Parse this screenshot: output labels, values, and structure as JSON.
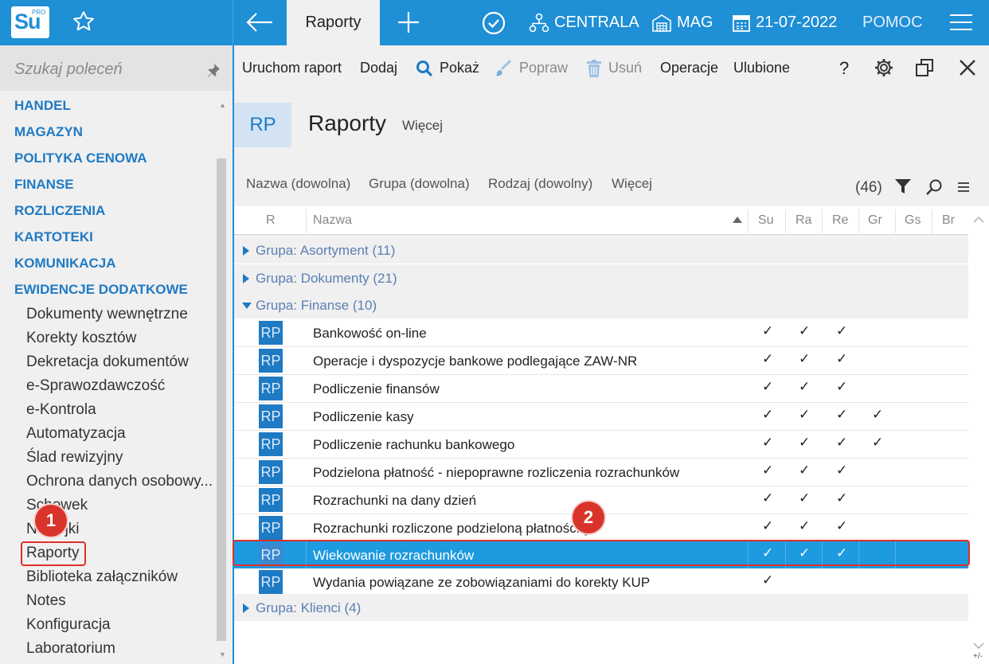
{
  "app": {
    "logo_text": "Su",
    "logo_sup": "PRO",
    "active_tab": "Raporty",
    "branch": "CENTRALA",
    "warehouse": "MAG",
    "date": "21-07-2022",
    "help": "POMOC"
  },
  "sidebar": {
    "search_placeholder": "Szukaj poleceń",
    "sections": [
      "HANDEL",
      "MAGAZYN",
      "POLITYKA CENOWA",
      "FINANSE",
      "ROZLICZENIA",
      "KARTOTEKI",
      "KOMUNIKACJA",
      "EWIDENCJE DODATKOWE"
    ],
    "items": [
      "Dokumenty wewnętrzne",
      "Korekty kosztów",
      "Dekretacja dokumentów",
      "e-Sprawozdawczość",
      "e-Kontrola",
      "Automatyzacja",
      "Ślad rewizyjny",
      "Ochrona danych osobowy...",
      "Schowek",
      "Naklejki",
      "Raporty",
      "Biblioteka załączników",
      "Notes",
      "Konfiguracja",
      "Laboratorium"
    ]
  },
  "toolbar": {
    "run": "Uruchom raport",
    "add": "Dodaj",
    "show": "Pokaż",
    "edit": "Popraw",
    "delete": "Usuń",
    "operations": "Operacje",
    "favorites": "Ulubione",
    "help_q": "?"
  },
  "header": {
    "badge": "RP",
    "title": "Raporty",
    "more": "Więcej"
  },
  "filters": {
    "name": "Nazwa (dowolna)",
    "group": "Grupa (dowolna)",
    "kind": "Rodzaj (dowolny)",
    "more": "Więcej",
    "count": "(46)"
  },
  "table": {
    "columns": [
      "R",
      "Nazwa",
      "Su",
      "Ra",
      "Re",
      "Gr",
      "Gs",
      "Br"
    ],
    "groups": [
      {
        "label": "Grupa: Asortyment (11)",
        "expanded": false
      },
      {
        "label": "Grupa: Dokumenty (21)",
        "expanded": false
      },
      {
        "label": "Grupa: Finanse (10)",
        "expanded": true
      },
      {
        "label": "Grupa: Klienci (4)",
        "expanded": false
      }
    ],
    "icon_text": "RP",
    "check": "✓",
    "rows": [
      {
        "name": "Bankowość on-line",
        "su": true,
        "ra": true,
        "re": true,
        "gr": false
      },
      {
        "name": "Operacje i dyspozycje bankowe podlegające ZAW-NR",
        "su": true,
        "ra": true,
        "re": true,
        "gr": false
      },
      {
        "name": "Podliczenie finansów",
        "su": true,
        "ra": true,
        "re": true,
        "gr": false
      },
      {
        "name": "Podliczenie kasy",
        "su": true,
        "ra": true,
        "re": true,
        "gr": true
      },
      {
        "name": "Podliczenie rachunku bankowego",
        "su": true,
        "ra": true,
        "re": true,
        "gr": true
      },
      {
        "name": "Podzielona płatność - niepoprawne rozliczenia rozrachunków",
        "su": true,
        "ra": true,
        "re": true,
        "gr": false
      },
      {
        "name": "Rozrachunki na dany dzień",
        "su": true,
        "ra": true,
        "re": true,
        "gr": false
      },
      {
        "name": "Rozrachunki rozliczone podzieloną płatnością",
        "su": true,
        "ra": true,
        "re": true,
        "gr": false
      },
      {
        "name": "Wiekowanie rozrachunków",
        "su": true,
        "ra": true,
        "re": true,
        "gr": false,
        "selected": true
      },
      {
        "name": "Wydania powiązane ze zobowiązaniami do korekty KUP",
        "su": true,
        "ra": false,
        "re": false,
        "gr": false
      }
    ]
  },
  "callouts": {
    "one": "1",
    "two": "2"
  },
  "corner": "+/-"
}
